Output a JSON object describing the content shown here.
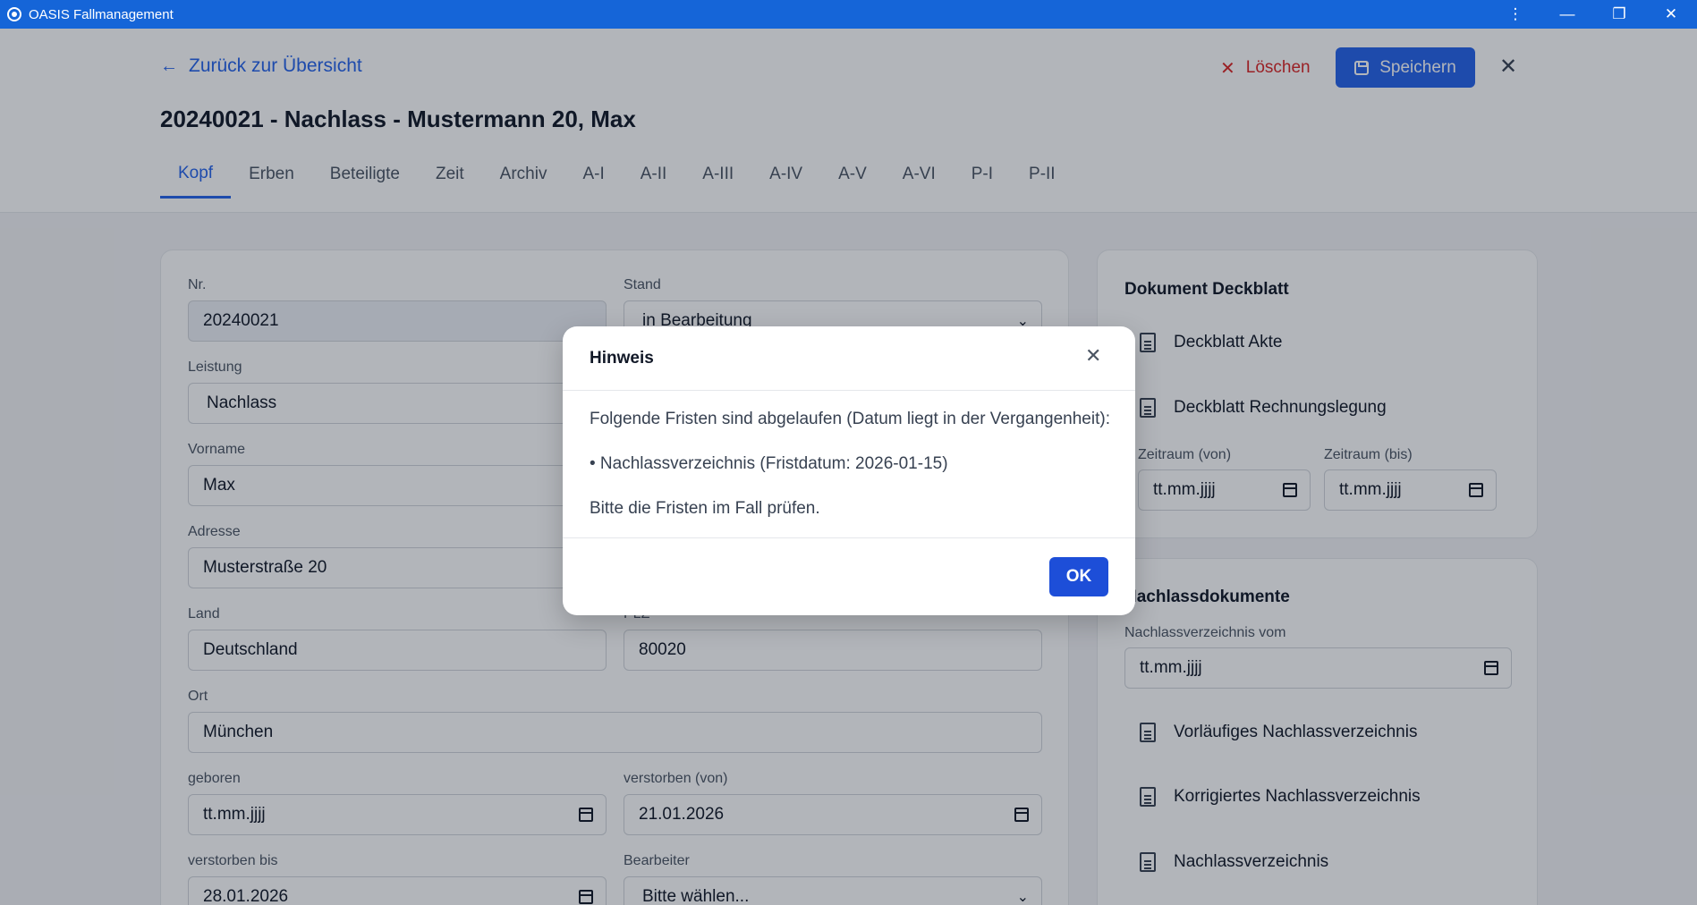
{
  "window": {
    "title": "OASIS Fallmanagement",
    "menu_icon": "⋮",
    "minimize_icon": "—",
    "maximize_icon": "❐",
    "close_icon": "✕"
  },
  "header": {
    "back_label": "Zurück zur Übersicht",
    "delete_label": "Löschen",
    "save_label": "Speichern",
    "case_title": "20240021 - Nachlass - Mustermann 20, Max",
    "tabs": [
      "Kopf",
      "Erben",
      "Beteiligte",
      "Zeit",
      "Archiv",
      "A-I",
      "A-II",
      "A-III",
      "A-IV",
      "A-V",
      "A-VI",
      "P-I",
      "P-II"
    ],
    "active_tab": "Kopf"
  },
  "form": {
    "nr": {
      "label": "Nr.",
      "value": "20240021"
    },
    "stand": {
      "label": "Stand",
      "value": "in Bearbeitung"
    },
    "leistung": {
      "label": "Leistung",
      "value": "Nachlass"
    },
    "vorname": {
      "label": "Vorname",
      "value": "Max"
    },
    "adresse": {
      "label": "Adresse",
      "value": "Musterstraße 20"
    },
    "land": {
      "label": "Land",
      "value": "Deutschland"
    },
    "plz": {
      "label": "PLZ",
      "value": "80020"
    },
    "ort": {
      "label": "Ort",
      "value": "München"
    },
    "geboren": {
      "label": "geboren",
      "value": "tt.mm.jjjj"
    },
    "verstorben_von": {
      "label": "verstorben (von)",
      "value": "21.01.2026"
    },
    "verstorben_bis": {
      "label": "verstorben bis",
      "value": "28.01.2026"
    },
    "bearbeiter": {
      "label": "Bearbeiter",
      "value": "Bitte wählen..."
    }
  },
  "deckblatt": {
    "title": "Dokument Deckblatt",
    "items": [
      "Deckblatt Akte",
      "Deckblatt Rechnungslegung"
    ],
    "zeitraum_von": {
      "label": "Zeitraum (von)",
      "value": "tt.mm.jjjj"
    },
    "zeitraum_bis": {
      "label": "Zeitraum (bis)",
      "value": "tt.mm.jjjj"
    }
  },
  "nachlass": {
    "title": "Nachlassdokumente",
    "verzeichnis_vom": {
      "label": "Nachlassverzeichnis vom",
      "value": "tt.mm.jjjj"
    },
    "items": [
      "Vorläufiges Nachlassverzeichnis",
      "Korrigiertes Nachlassverzeichnis",
      "Nachlassverzeichnis"
    ]
  },
  "modal": {
    "title": "Hinweis",
    "line1": "Folgende Fristen sind abgelaufen (Datum liegt in der Vergangenheit):",
    "line2": "• Nachlassverzeichnis (Fristdatum: 2026-01-15)",
    "line3": "Bitte die Fristen im Fall prüfen.",
    "ok_label": "OK"
  },
  "colors": {
    "accent": "#2563eb",
    "titlebar": "#1565d8",
    "danger": "#dc2626"
  }
}
